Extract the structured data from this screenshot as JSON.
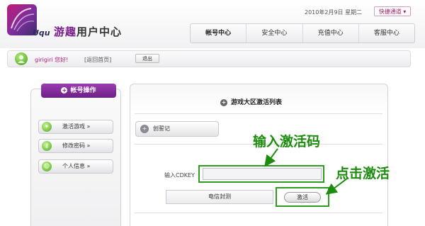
{
  "header": {
    "brand_en": "Uqu",
    "brand_accent": "游趣",
    "brand_rest": "用户中心",
    "date_text": "2010年2月9日  星期二",
    "quick_link": "快捷通道 ▾",
    "nav": [
      {
        "label": "帐号中心",
        "active": true
      },
      {
        "label": "安全中心"
      },
      {
        "label": "充值中心"
      },
      {
        "label": "客服中心"
      }
    ]
  },
  "userbar": {
    "username": "girigiri 您好!",
    "home_link": "[返回首页]",
    "logout": "退出"
  },
  "sidebar": {
    "title": "帐号操作",
    "items": [
      {
        "label": "激活游戏 »",
        "icon": "gamepad-icon"
      },
      {
        "label": "修改密码 »",
        "icon": "key-icon"
      },
      {
        "label": "个人信息 »",
        "icon": "person-icon"
      }
    ]
  },
  "main": {
    "title": "游戏大区激活列表",
    "create_btn": "创誓记",
    "cdkey_label": "输入CDKEY",
    "cdkey_value": "",
    "server_name": "电信封测",
    "activate_btn": "激活"
  },
  "annotations": {
    "input_hint": "输入激活码",
    "click_hint": "点击激活",
    "highlight_color": "#2e9c1e"
  },
  "colors": {
    "brand_purple": "#7a1d8c",
    "username_pink": "#b0207a"
  }
}
